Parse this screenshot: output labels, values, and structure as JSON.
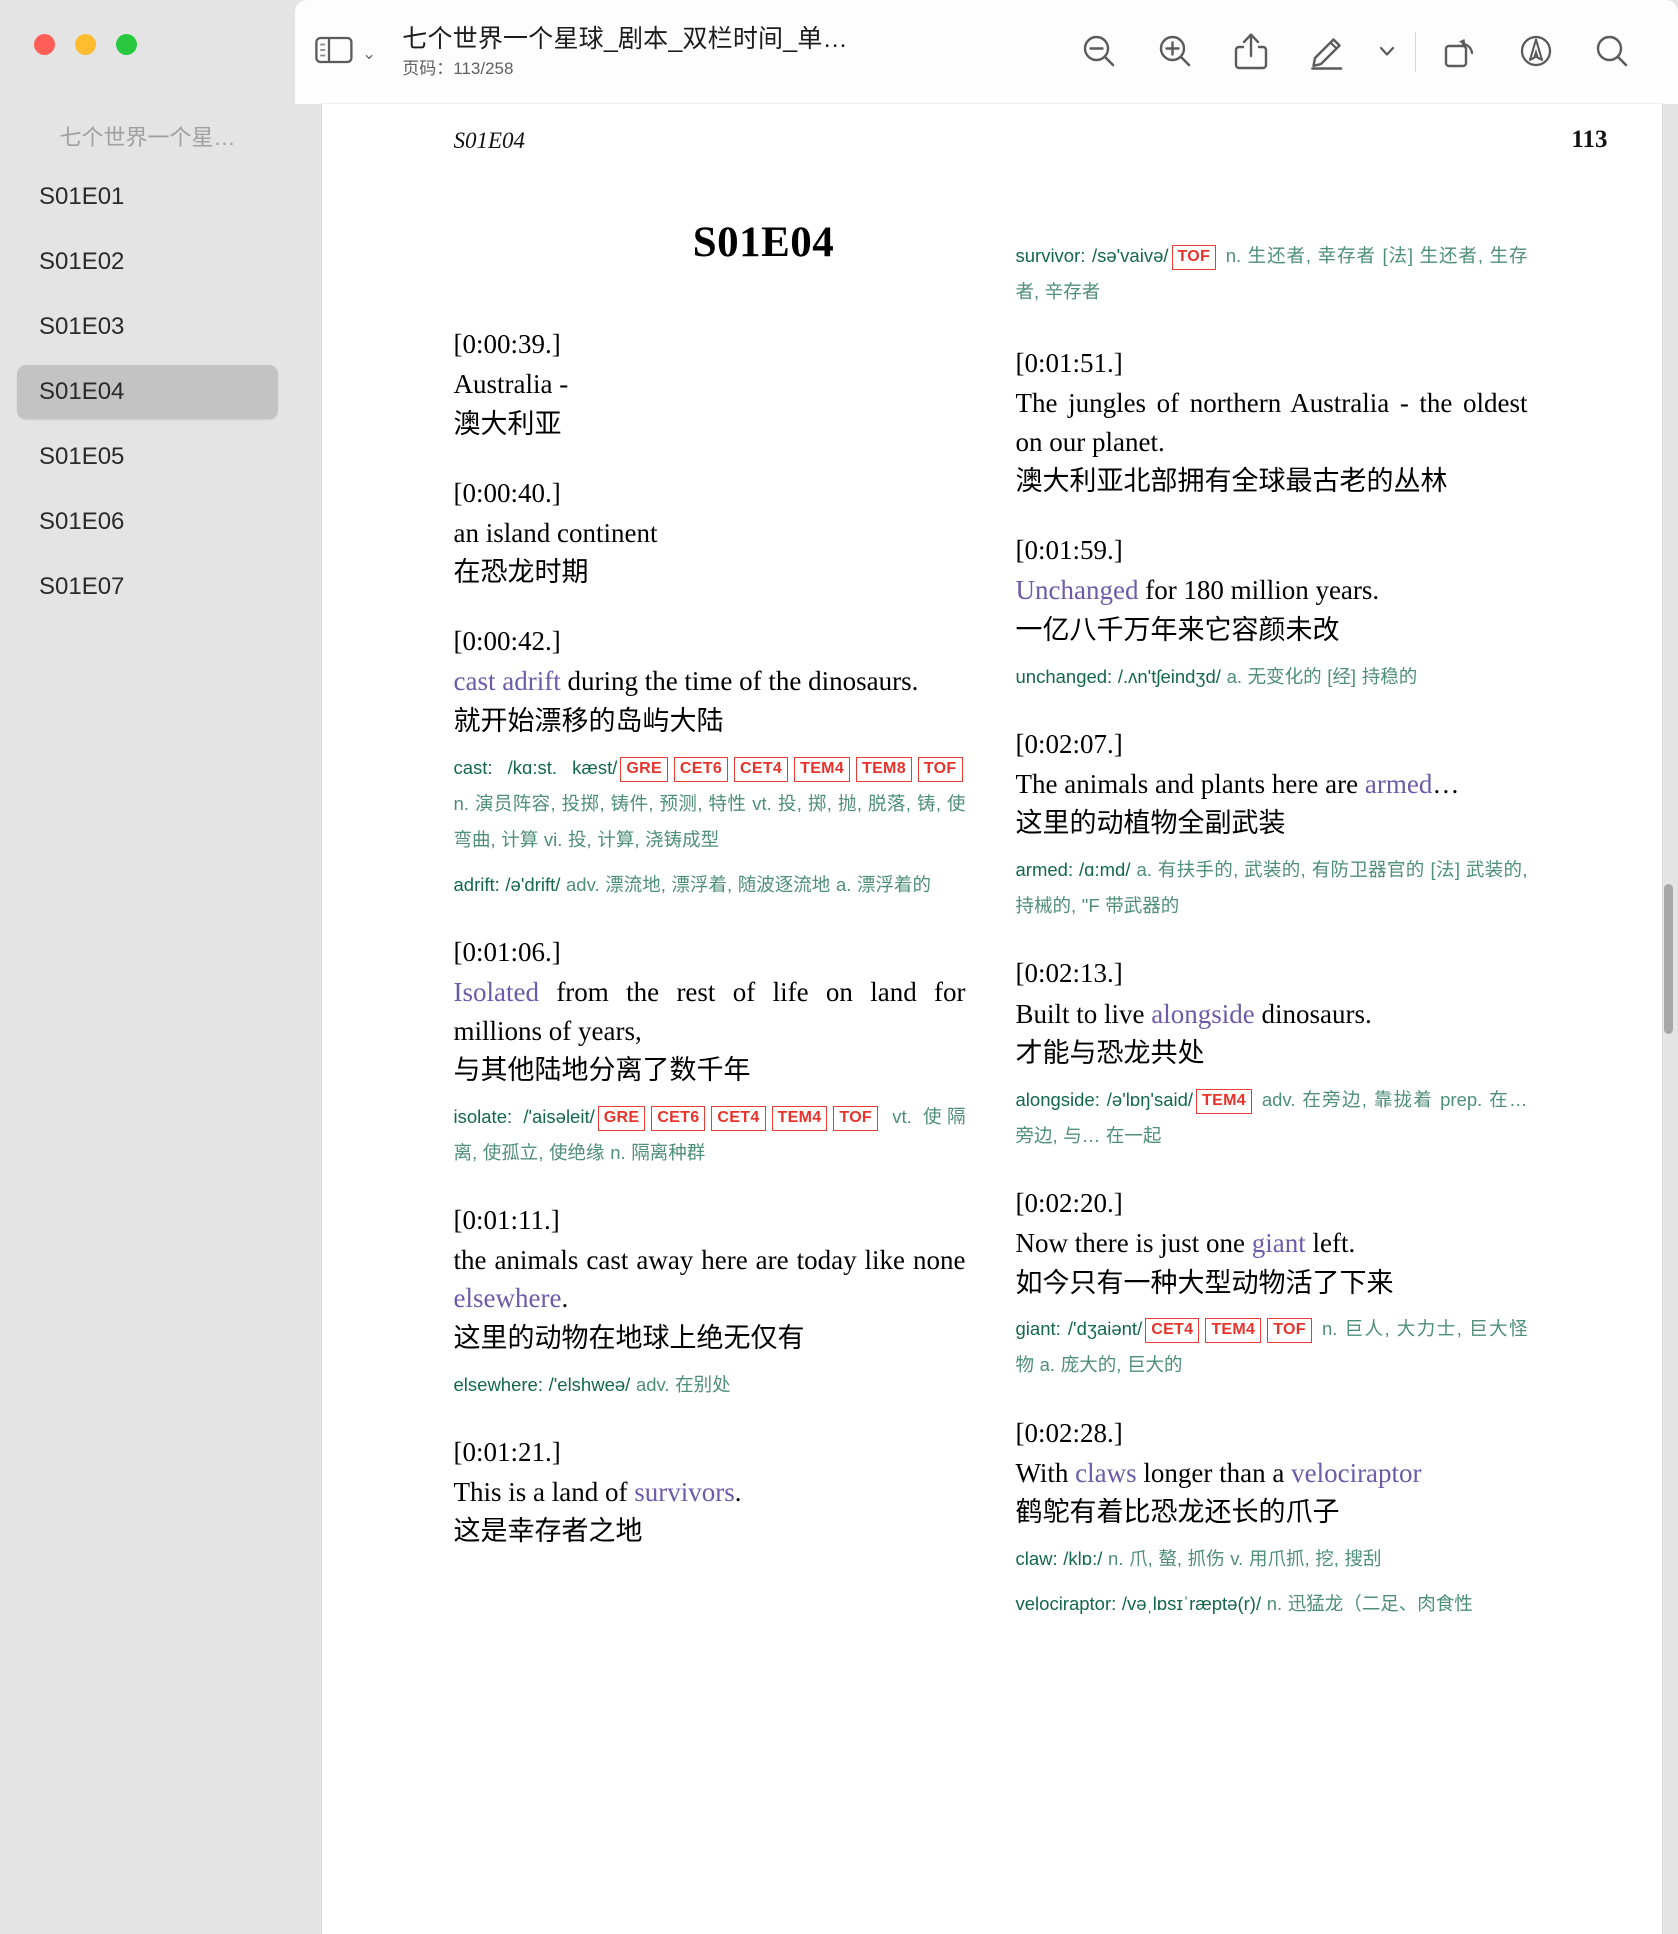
{
  "window": {
    "traffic_lights": [
      "close",
      "minimize",
      "maximize"
    ]
  },
  "toolbar": {
    "sidebar_toggle_icon": "sidebar-icon",
    "sidebar_chevron": "⌄",
    "doc_title": "七个世界一个星球_剧本_双栏时间_单…",
    "page_indicator": "页码：113/258",
    "actions": [
      {
        "name": "zoom-out-button",
        "icon": "zoom-out-icon"
      },
      {
        "name": "zoom-in-button",
        "icon": "zoom-in-icon"
      },
      {
        "name": "share-button",
        "icon": "share-icon"
      },
      {
        "name": "markup-button",
        "icon": "pencil-icon"
      },
      {
        "name": "markup-dropdown-button",
        "icon": "chevron-down-icon"
      },
      {
        "name": "rotate-button",
        "icon": "rotate-left-icon"
      },
      {
        "name": "annotate-button",
        "icon": "annotate-circle-icon"
      },
      {
        "name": "search-button",
        "icon": "search-icon"
      }
    ]
  },
  "sidebar": {
    "title": "七个世界一个星…",
    "items": [
      {
        "label": "S01E01",
        "active": false
      },
      {
        "label": "S01E02",
        "active": false
      },
      {
        "label": "S01E03",
        "active": false
      },
      {
        "label": "S01E04",
        "active": true
      },
      {
        "label": "S01E05",
        "active": false
      },
      {
        "label": "S01E06",
        "active": false
      },
      {
        "label": "S01E07",
        "active": false
      }
    ]
  },
  "document": {
    "running_head_left": "S01E04",
    "page_number": "113",
    "heading": "S01E04",
    "left_column": [
      {
        "timestamp": "[0:00:39.]",
        "english": "Australia -",
        "chinese": "澳大利亚",
        "dict": []
      },
      {
        "timestamp": "[0:00:40.]",
        "english": "an island continent",
        "chinese": "在恐龙时期",
        "dict": []
      },
      {
        "timestamp": "[0:00:42.]",
        "english_pre": "",
        "english_hl": "cast adrift",
        "english_post": " during the time of the dinosaurs.",
        "chinese": "就开始漂移的岛屿大陆",
        "dict": [
          {
            "word": "cast:",
            "ipa": "/kɑ:st. kæst/",
            "tags": [
              "GRE",
              "CET6",
              "CET4",
              "TEM4",
              "TEM8",
              "TOF"
            ],
            "defs": "n. 演员阵容, 投掷, 铸件, 预测, 特性 vt. 投, 掷, 抛, 脱落, 铸, 使弯曲, 计算 vi. 投, 计算, 浇铸成型"
          },
          {
            "word": "adrift:",
            "ipa": "/ə'drift/",
            "tags": [],
            "defs": "adv. 漂流地, 漂浮着, 随波逐流地 a. 漂浮着的"
          }
        ]
      },
      {
        "timestamp": "[0:01:06.]",
        "english_pre": "",
        "english_hl": "Isolated",
        "english_post": " from the rest of life on land for millions of years,",
        "chinese": "与其他陆地分离了数千年",
        "dict": [
          {
            "word": "isolate:",
            "ipa": "/'aisəleit/",
            "tags": [
              "GRE",
              "CET6",
              "CET4",
              "TEM4",
              "TOF"
            ],
            "defs": "vt. 使隔离, 使孤立, 使绝缘 n. 隔离种群"
          }
        ]
      },
      {
        "timestamp": "[0:01:11.]",
        "english_pre": "the animals cast away here are today like none ",
        "english_hl": "elsewhere",
        "english_post": ".",
        "chinese": "这里的动物在地球上绝无仅有",
        "dict": [
          {
            "word": "elsewhere:",
            "ipa": "/'elshweə/",
            "tags": [],
            "defs": "adv. 在别处"
          }
        ]
      },
      {
        "timestamp": "[0:01:21.]",
        "english_pre": "This is a land of ",
        "english_hl": "survivors",
        "english_post": ".",
        "chinese": "这是幸存者之地",
        "dict": []
      }
    ],
    "right_column_top_dict": {
      "word": "survivor:",
      "ipa": "/sə'vaivə/",
      "tags": [
        "TOF"
      ],
      "defs": "n. 生还者, 幸存者 [法] 生还者, 生存者, 辛存者"
    },
    "right_column": [
      {
        "timestamp": "[0:01:51.]",
        "english_pre": "The jungles of northern Australia - the oldest on our planet.",
        "english_hl": "",
        "english_post": "",
        "chinese": "澳大利亚北部拥有全球最古老的丛林",
        "dict": []
      },
      {
        "timestamp": "[0:01:59.]",
        "english_pre": "",
        "english_hl": "Unchanged",
        "english_post": " for 180 million years.",
        "chinese": "一亿八千万年来它容颜未改",
        "dict": [
          {
            "word": "unchanged:",
            "ipa": "/.ʌn'tʃeindʒd/",
            "tags": [],
            "defs": "a. 无变化的 [经] 持稳的"
          }
        ]
      },
      {
        "timestamp": "[0:02:07.]",
        "english_pre": "The animals and plants here are ",
        "english_hl": "armed",
        "english_post": "…",
        "chinese": "这里的动植物全副武装",
        "dict": [
          {
            "word": "armed:",
            "ipa": "/ɑ:md/",
            "tags": [],
            "defs": "a. 有扶手的, 武装的, 有防卫器官的 [法] 武装的, 持械的, \"F 带武器的"
          }
        ]
      },
      {
        "timestamp": "[0:02:13.]",
        "english_pre": "Built to live ",
        "english_hl": "alongside",
        "english_post": " dinosaurs.",
        "chinese": "才能与恐龙共处",
        "dict": [
          {
            "word": "alongside:",
            "ipa": "/ə'lɒŋ'said/",
            "tags": [
              "TEM4"
            ],
            "defs": "adv. 在旁边, 靠拢着 prep. 在… 旁边, 与… 在一起"
          }
        ]
      },
      {
        "timestamp": "[0:02:20.]",
        "english_pre": "Now there is just one ",
        "english_hl": "giant",
        "english_post": " left.",
        "chinese": "如今只有一种大型动物活了下来",
        "dict": [
          {
            "word": "giant:",
            "ipa": "/'dʒaiənt/",
            "tags": [
              "CET4",
              "TEM4",
              "TOF"
            ],
            "defs": "n. 巨人, 大力士, 巨大怪物 a. 庞大的, 巨大的"
          }
        ]
      },
      {
        "timestamp": "[0:02:28.]",
        "english_pre": "With ",
        "english_hl": "claws",
        "english_post": " longer than a ",
        "english_hl2": "velociraptor",
        "chinese": "鹤鸵有着比恐龙还长的爪子",
        "dict": [
          {
            "word": "claw:",
            "ipa": "/klɒ:/",
            "tags": [],
            "defs": "n. 爪, 螯, 抓伤 v. 用爪抓, 挖, 搜刮"
          },
          {
            "word": "velociraptor:",
            "ipa": "/vəˌlɒsɪˈræptə(r)/",
            "tags": [],
            "defs": "n. 迅猛龙（二足、肉食性"
          }
        ]
      }
    ]
  },
  "colors": {
    "highlight_word": "#6b5ba8",
    "dict_text": "#1f6b52",
    "tag_border": "#ea3b34",
    "sidebar_bg": "#e4e4e4",
    "sidebar_active": "#c3c3c3"
  }
}
